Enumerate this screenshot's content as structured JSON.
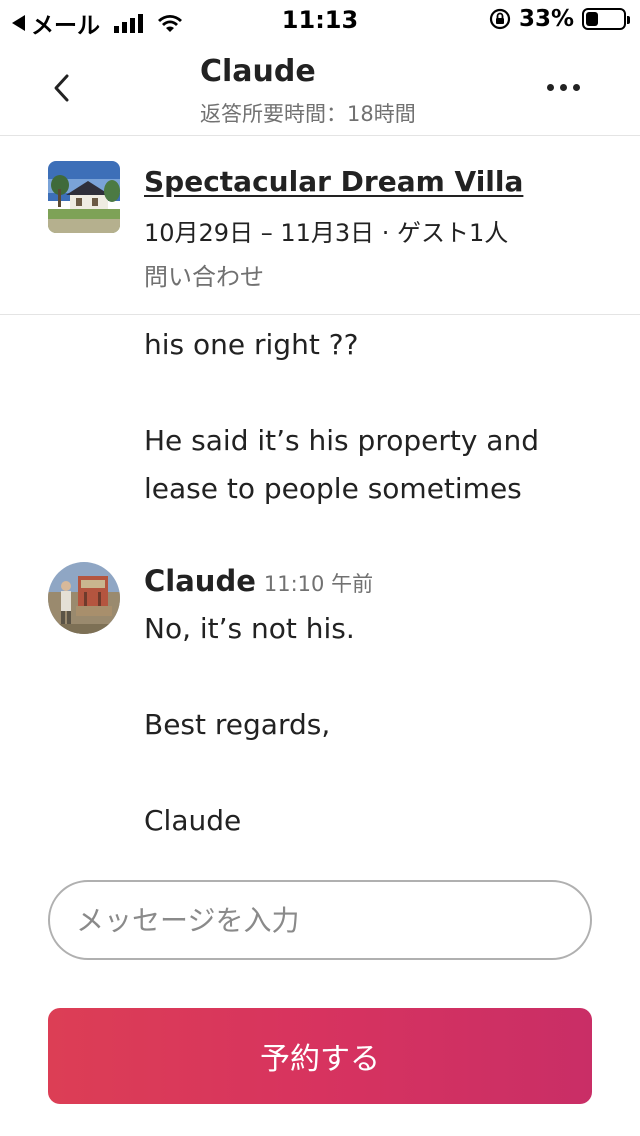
{
  "status_bar": {
    "carrier": "メール",
    "time": "11:13",
    "battery_percent": "33%",
    "battery_level": 0.33
  },
  "header": {
    "contact_name": "Claude",
    "response_time": "返答所要時間：18時間",
    "back_icon": "chevron-left-icon",
    "more_icon": "more-horizontal-icon"
  },
  "listing": {
    "title": "Spectacular Dream Villa",
    "dates": "10月29日 – 11月3日 · ゲスト1人",
    "status": "問い合わせ"
  },
  "messages": {
    "previous_lines": [
      "his one right ??",
      "He said it’s his property and",
      "lease to people sometimes"
    ],
    "reply": {
      "sender": "Claude",
      "time": "11:10 午前",
      "lines": [
        "No, it’s not his.",
        "Best regards,",
        "Claude"
      ]
    }
  },
  "composer": {
    "placeholder": "メッセージを入力",
    "value": ""
  },
  "reserve_button": {
    "label": "予約する"
  },
  "colors": {
    "accent_start": "#dc3e55",
    "accent_end": "#c92e66",
    "text_primary": "#222222",
    "text_secondary": "#717171"
  }
}
